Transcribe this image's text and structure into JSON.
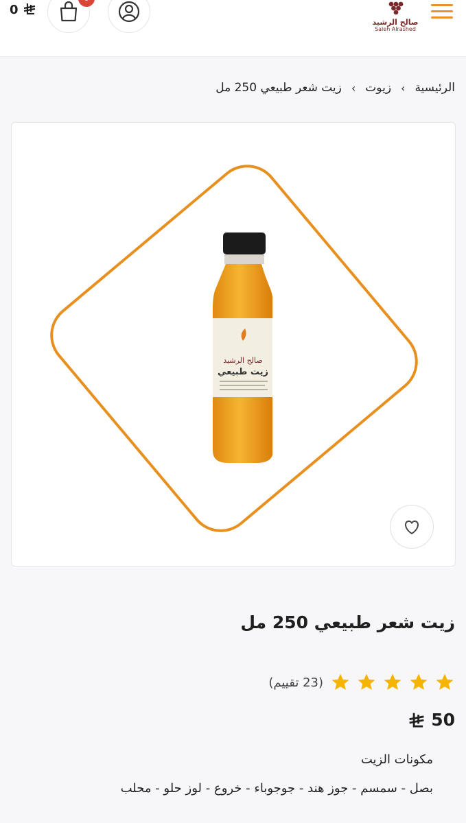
{
  "header": {
    "logo_text": "صالح الرشيد",
    "logo_text_en": "Saleh Alrashed",
    "cart_total": "0",
    "cart_badge": "0",
    "brand_color": "#e8902b"
  },
  "breadcrumb": {
    "items": [
      "الرئيسية",
      "زيوت",
      "زيت شعر طبيعي 250 مل"
    ]
  },
  "product": {
    "title": "زيت شعر طبيعي 250 مل",
    "rating_stars": 5,
    "rating_count": "(23 تقييم)",
    "price": "50",
    "ingredients_title": "مكونات الزيت",
    "ingredients": "بصل - سمسم - جوز هند - جوجوباء - خروع - لوز حلو - محلب",
    "label_brand": "صالح الرشيد",
    "label_name": "زيت طبيعي"
  },
  "colors": {
    "accent": "#e8901f",
    "star": "#f5b400",
    "badge": "#d8453b"
  }
}
